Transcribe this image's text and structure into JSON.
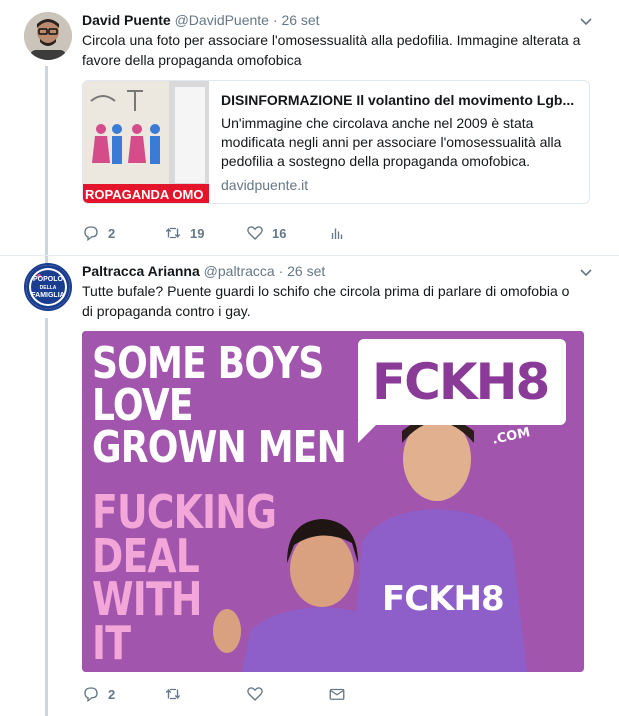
{
  "tweets": [
    {
      "name": "David Puente",
      "handle": "@DavidPuente",
      "dot": "·",
      "date": "26 set",
      "text": "Circola una foto per associare l'omosessualità alla pedofilia. Immagine alterata a favore della propaganda omofobica",
      "card": {
        "thumb_caption": "ROPAGANDA OMO",
        "title": "DISINFORMAZIONE Il volantino del movimento Lgb...",
        "description": "Un'immagine che circolava anche nel 2009 è stata modificata negli anni per associare l'omosessualità alla pedofilia a sostegno della propaganda omofobica.",
        "url": "davidpuente.it"
      },
      "actions": {
        "replies": "2",
        "retweets": "19",
        "likes": "16"
      }
    },
    {
      "name": "Paltracca Arianna",
      "handle": "@paltracca",
      "dot": "·",
      "date": "26 set",
      "avatar_text": [
        "POPOLO",
        "DELLA",
        "FAMIGLIA"
      ],
      "text": "Tutte bufale? Puente guardi lo schifo che circola prima di parlare di omofobia o di propaganda contro i gay.",
      "media": {
        "white_lines": [
          "SOME BOYS",
          "LOVE",
          "GROWN MEN"
        ],
        "pink_lines": [
          "FUCKING",
          "DEAL",
          "WITH",
          "IT"
        ],
        "logo": "FCKH8",
        "logo_suffix": ".COM",
        "shirt_text": "FCKH8"
      },
      "actions": {
        "replies": "2"
      }
    }
  ],
  "colors": {
    "icon": "#657786",
    "media_bg": "#a155ad",
    "pink_text": "#f2a7d8",
    "logo_purple": "#8a3a97"
  }
}
